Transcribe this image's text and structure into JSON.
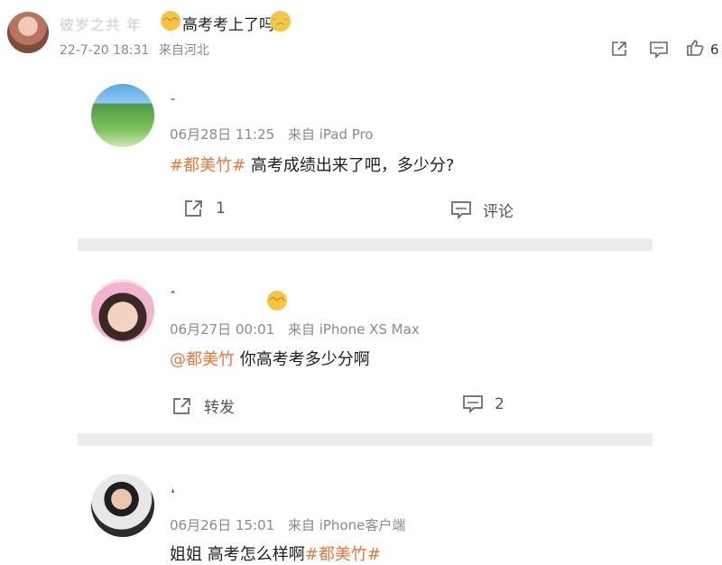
{
  "top_comment": {
    "username": "彼岁之共 年",
    "text": "高考考上了吗",
    "date": "22-7-20 18:31",
    "location": "来自河北",
    "like_count": "6"
  },
  "posts": [
    {
      "username": "ˉ",
      "date": "06月28日 11:25",
      "source": "来自 iPad Pro",
      "hashtag": "#都美竹#",
      "text": " 高考成绩出来了吧，多少分?",
      "repost_label": "1",
      "comment_label": "评论"
    },
    {
      "username": "ˆ",
      "date": "06月27日 00:01",
      "source": "来自 iPhone XS Max",
      "mention": "@都美竹",
      "text": " 你高考考多少分啊",
      "repost_label": "转发",
      "comment_label": "2"
    },
    {
      "username": "˔",
      "date": "06月26日 15:01",
      "source": "来自 iPhone客户端",
      "text": "姐姐 高考怎么样啊",
      "hashtag": "#都美竹#"
    }
  ]
}
